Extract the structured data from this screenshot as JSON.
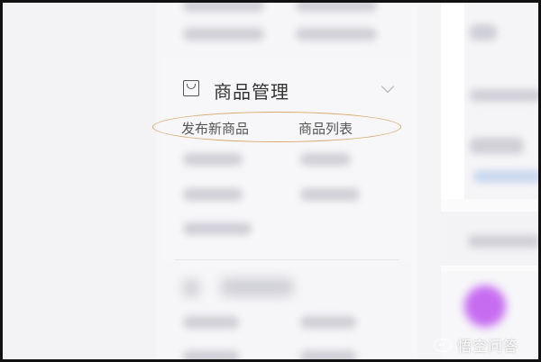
{
  "section": {
    "title": "商品管理",
    "icon": "shopping-bag-icon",
    "expand_icon": "chevron-down-icon",
    "items": [
      {
        "label": "发布新商品"
      },
      {
        "label": "商品列表"
      }
    ]
  },
  "highlight": {
    "color": "#d9a86f"
  },
  "watermark": {
    "icon": "chat-bubble-icon",
    "text": "悟空问答"
  }
}
